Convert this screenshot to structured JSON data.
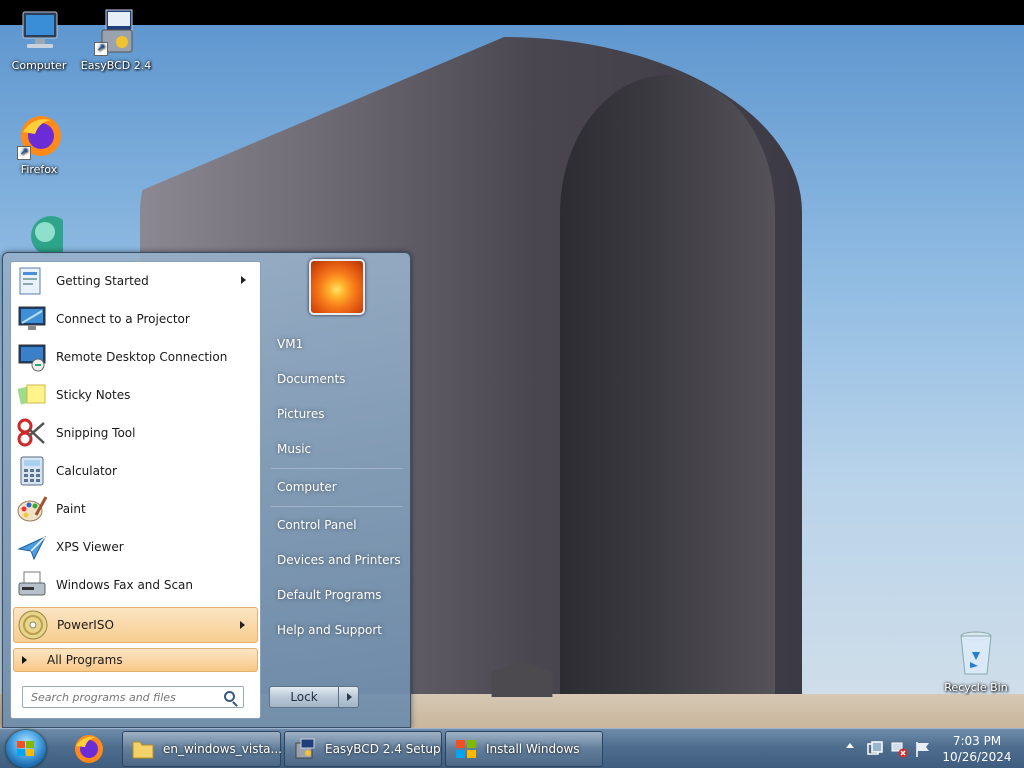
{
  "desktop": {
    "icons": [
      {
        "label": "Computer",
        "icon": "computer-icon"
      },
      {
        "label": "EasyBCD 2.4",
        "icon": "easybcd-icon"
      },
      {
        "label": "Firefox",
        "icon": "firefox-icon"
      },
      {
        "label": "",
        "icon": "app-icon"
      },
      {
        "label": "Recycle Bin",
        "icon": "recycle-bin-icon"
      }
    ]
  },
  "start_menu": {
    "programs": [
      {
        "label": "Getting Started",
        "icon": "getting-started-icon",
        "submenu": true
      },
      {
        "label": "Connect to a Projector",
        "icon": "projector-icon",
        "submenu": false
      },
      {
        "label": "Remote Desktop Connection",
        "icon": "remote-desktop-icon",
        "submenu": false
      },
      {
        "label": "Sticky Notes",
        "icon": "sticky-notes-icon",
        "submenu": false
      },
      {
        "label": "Snipping Tool",
        "icon": "snipping-tool-icon",
        "submenu": false
      },
      {
        "label": "Calculator",
        "icon": "calculator-icon",
        "submenu": false
      },
      {
        "label": "Paint",
        "icon": "paint-icon",
        "submenu": false
      },
      {
        "label": "XPS Viewer",
        "icon": "xps-viewer-icon",
        "submenu": false
      },
      {
        "label": "Windows Fax and Scan",
        "icon": "fax-scan-icon",
        "submenu": false
      },
      {
        "label": "PowerISO",
        "icon": "poweriso-icon",
        "submenu": true,
        "highlighted": true
      }
    ],
    "all_programs": "All Programs",
    "search_placeholder": "Search programs and files",
    "right_links": [
      "VM1",
      "Documents",
      "Pictures",
      "Music",
      "Computer",
      "Control Panel",
      "Devices and Printers",
      "Default Programs",
      "Help and Support"
    ],
    "lock_label": "Lock"
  },
  "taskbar": {
    "buttons": [
      {
        "label": "en_windows_vista...",
        "icon": "folder-icon"
      },
      {
        "label": "EasyBCD 2.4 Setup",
        "icon": "easybcd-setup-icon"
      },
      {
        "label": "Install Windows",
        "icon": "windows-setup-icon"
      }
    ],
    "clock": {
      "time": "7:03 PM",
      "date": "10/26/2024"
    }
  },
  "colors": {
    "taskbar": "#4f6e8f",
    "highlight": "#f7cd8f",
    "start_menu_frame": "#8ea6be"
  }
}
